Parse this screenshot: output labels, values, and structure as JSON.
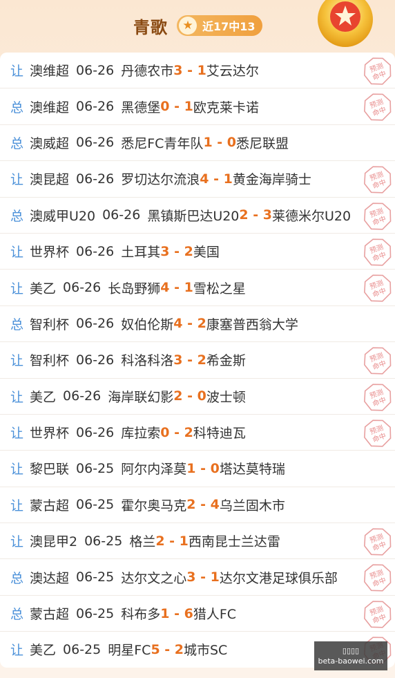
{
  "header": {
    "title": "青歌",
    "record": "近17中13",
    "colors": {
      "accent": "#e8701f",
      "title": "#8a4a12",
      "type": "#4a90d9"
    }
  },
  "stamp_text": "预测命中",
  "rows": [
    {
      "type": "让",
      "league": "澳维超",
      "date": "06-26",
      "home": "丹德农市",
      "score": "3 - 1",
      "away": "艾云达尔",
      "hit": true
    },
    {
      "type": "总",
      "league": "澳维超",
      "date": "06-26",
      "home": "黑德堡",
      "score": "0 - 1",
      "away": "欧克莱卡诺",
      "hit": true
    },
    {
      "type": "总",
      "league": "澳威超",
      "date": "06-26",
      "home": "悉尼FC青年队",
      "score": "1 - 0",
      "away": "悉尼联盟",
      "hit": false
    },
    {
      "type": "让",
      "league": "澳昆超",
      "date": "06-26",
      "home": "罗切达尔流浪",
      "score": "4 - 1",
      "away": "黄金海岸骑士",
      "hit": true
    },
    {
      "type": "总",
      "league": "澳威甲U20",
      "date": "06-26",
      "home": "黑镇斯巴达U20",
      "score": "2 - 3",
      "away": "莱德米尔U20",
      "hit": true
    },
    {
      "type": "让",
      "league": "世界杯",
      "date": "06-26",
      "home": "土耳其",
      "score": "3 - 2",
      "away": "美国",
      "hit": true
    },
    {
      "type": "让",
      "league": "美乙",
      "date": "06-26",
      "home": "长岛野狮",
      "score": "4 - 1",
      "away": "雪松之星",
      "hit": true
    },
    {
      "type": "总",
      "league": "智利杯",
      "date": "06-26",
      "home": "奴伯伦斯",
      "score": "4 - 2",
      "away": "康塞普西翁大学",
      "hit": false
    },
    {
      "type": "让",
      "league": "智利杯",
      "date": "06-26",
      "home": "科洛科洛",
      "score": "3 - 2",
      "away": "希金斯",
      "hit": true
    },
    {
      "type": "让",
      "league": "美乙",
      "date": "06-26",
      "home": "海岸联幻影",
      "score": "2 - 0",
      "away": "波士顿",
      "hit": true
    },
    {
      "type": "让",
      "league": "世界杯",
      "date": "06-26",
      "home": "库拉索",
      "score": "0 - 2",
      "away": "科特迪瓦",
      "hit": true
    },
    {
      "type": "让",
      "league": "黎巴联",
      "date": "06-25",
      "home": "阿尔内泽莫",
      "score": "1 - 0",
      "away": "塔达莫特瑞",
      "hit": false
    },
    {
      "type": "让",
      "league": "蒙古超",
      "date": "06-25",
      "home": "霍尔奥马克",
      "score": "2 - 4",
      "away": "乌兰固木市",
      "hit": false
    },
    {
      "type": "让",
      "league": "澳昆甲2",
      "date": "06-25",
      "home": "格兰",
      "score": "2 - 1",
      "away": "西南昆士兰达雷",
      "hit": true
    },
    {
      "type": "总",
      "league": "澳达超",
      "date": "06-25",
      "home": "达尔文之心",
      "score": "3 - 1",
      "away": "达尔文港足球俱乐部",
      "hit": true
    },
    {
      "type": "总",
      "league": "蒙古超",
      "date": "06-25",
      "home": "科布多",
      "score": "1 - 6",
      "away": "猎人FC",
      "hit": true
    },
    {
      "type": "让",
      "league": "美乙",
      "date": "06-25",
      "home": "明星FC",
      "score": "5 - 2",
      "away": "城市SC",
      "hit": true
    }
  ],
  "watermark": {
    "line1": "▯▯▯▯",
    "line2": "beta-baowei.com"
  }
}
